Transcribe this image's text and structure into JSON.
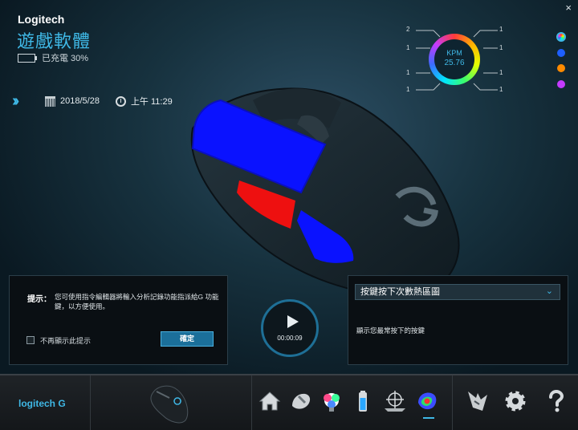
{
  "app": {
    "brand": "Logitech",
    "title": "遊戲軟體",
    "battery_text": "已充電 30%",
    "close_label": "×"
  },
  "status": {
    "date": "2018/5/28",
    "time": "上午 11:29"
  },
  "kpm": {
    "label": "KPM",
    "value": "25.76",
    "left_counts": [
      "2",
      "1",
      "1",
      "1"
    ],
    "right_counts": [
      "1",
      "1",
      "1",
      "1"
    ]
  },
  "color_swatches": [
    "#3fb8e6",
    "#1e5fff",
    "#ff8a00",
    "#c43bff"
  ],
  "hint_panel": {
    "label": "提示：",
    "text": "您可使用指令編輯器將輸入分析記錄功能指派給G 功能鍵，以方便使用。",
    "checkbox_label": "不再顯示此提示",
    "ok_label": "確定"
  },
  "heatmap_panel": {
    "selected": "按鍵按下次數熱區圖",
    "description": "顯示您最常按下的按鍵"
  },
  "playback": {
    "time": "00:00:09"
  },
  "footer": {
    "logo": "logitech G",
    "nav_icons": [
      "home-icon",
      "customize-buttons-icon",
      "lighting-icon",
      "battery-icon",
      "pointer-settings-icon",
      "heatmap-icon",
      "arx-control-icon",
      "settings-icon",
      "help-icon"
    ]
  }
}
